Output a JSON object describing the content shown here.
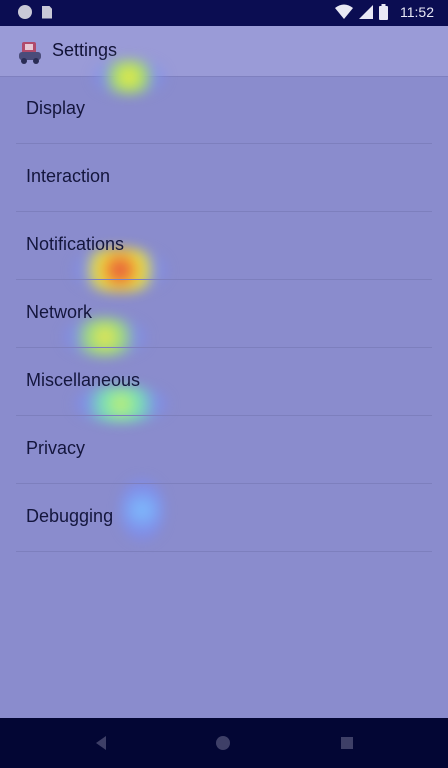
{
  "status_bar": {
    "time": "11:52",
    "icons": [
      "notification-dot-icon",
      "sd-card-icon",
      "wifi-icon",
      "cell-signal-icon",
      "battery-icon"
    ]
  },
  "app_bar": {
    "title": "Settings",
    "logo_icon": "app-logo-icon"
  },
  "settings": {
    "items": [
      {
        "label": "Display"
      },
      {
        "label": "Interaction"
      },
      {
        "label": "Notifications"
      },
      {
        "label": "Network"
      },
      {
        "label": "Miscellaneous"
      },
      {
        "label": "Privacy"
      },
      {
        "label": "Debugging"
      }
    ]
  },
  "nav_bar": {
    "icons": [
      "back-icon",
      "home-icon",
      "recents-icon"
    ]
  },
  "colors": {
    "background": "#8a8ccd",
    "status_bar": "#0b0d52",
    "nav_bar": "#030634",
    "text": "#14163d"
  }
}
